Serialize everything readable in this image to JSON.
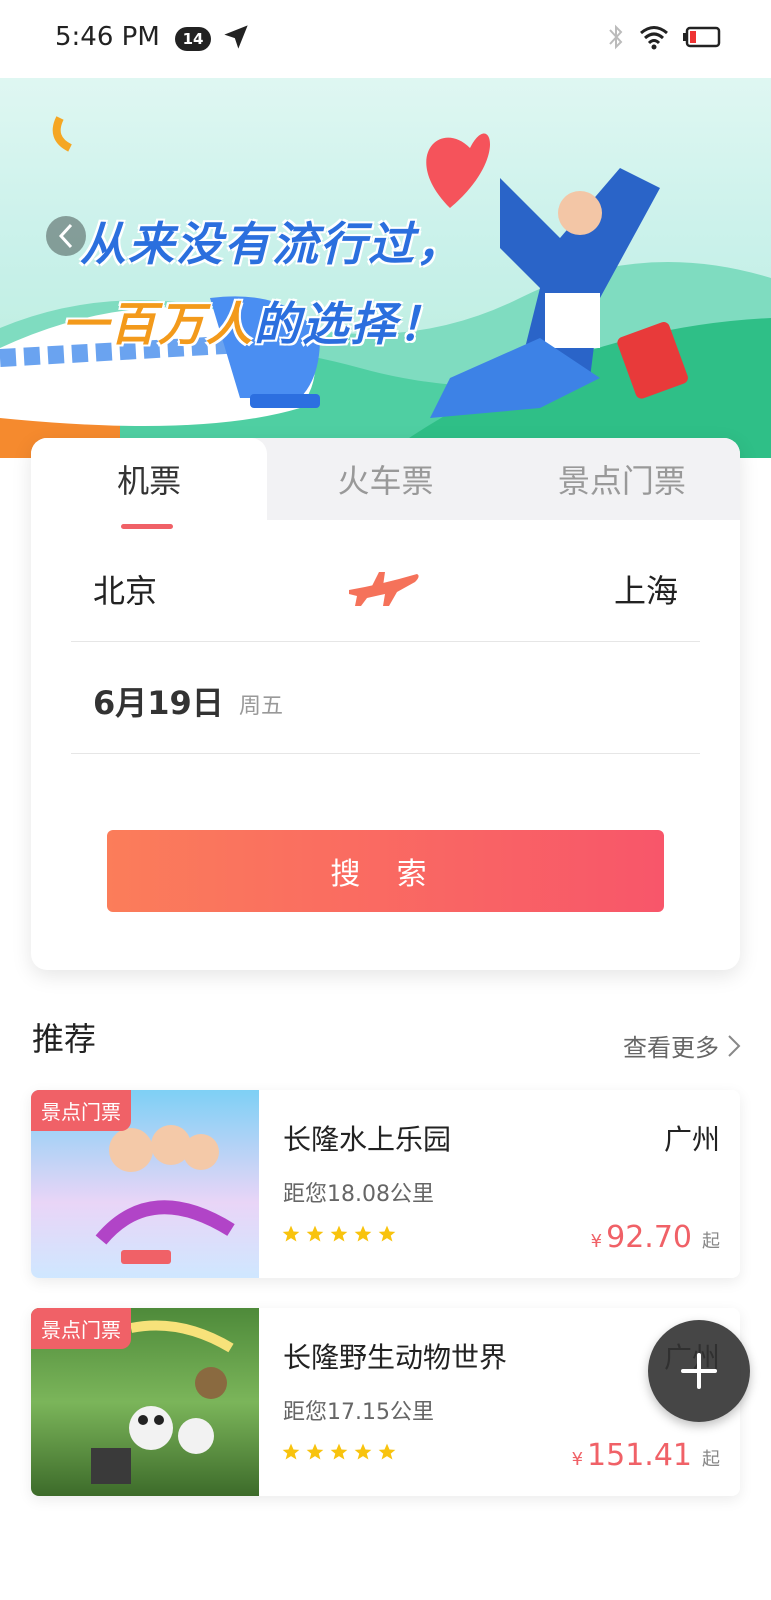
{
  "status_bar": {
    "time": "5:46 PM",
    "badge": "14"
  },
  "banner": {
    "slogan_line1": "从来没有流行过，",
    "slogan_line2_a": "一百万人",
    "slogan_line2_b": "的选择！"
  },
  "booking": {
    "tabs": [
      {
        "label": "机票",
        "active": true
      },
      {
        "label": "火车票",
        "active": false
      },
      {
        "label": "景点门票",
        "active": false
      }
    ],
    "from_city": "北京",
    "to_city": "上海",
    "date": "6月19日",
    "weekday": "周五",
    "search_label": "搜 索"
  },
  "recommend": {
    "title": "推荐",
    "more_label": "查看更多",
    "items": [
      {
        "tag": "景点门票",
        "name": "长隆水上乐园",
        "city": "广州",
        "distance": "距您18.08公里",
        "stars": 5,
        "currency": "¥",
        "price": "92.70",
        "price_suffix": "起"
      },
      {
        "tag": "景点门票",
        "name": "长隆野生动物世界",
        "city": "广州",
        "distance": "距您17.15公里",
        "stars": 5,
        "currency": "¥",
        "price": "151.41",
        "price_suffix": "起"
      }
    ]
  },
  "colors": {
    "accent": "#f06167",
    "gradient_start": "#fb7d5a",
    "gradient_end": "#f8566a",
    "star": "#f8c30e"
  }
}
